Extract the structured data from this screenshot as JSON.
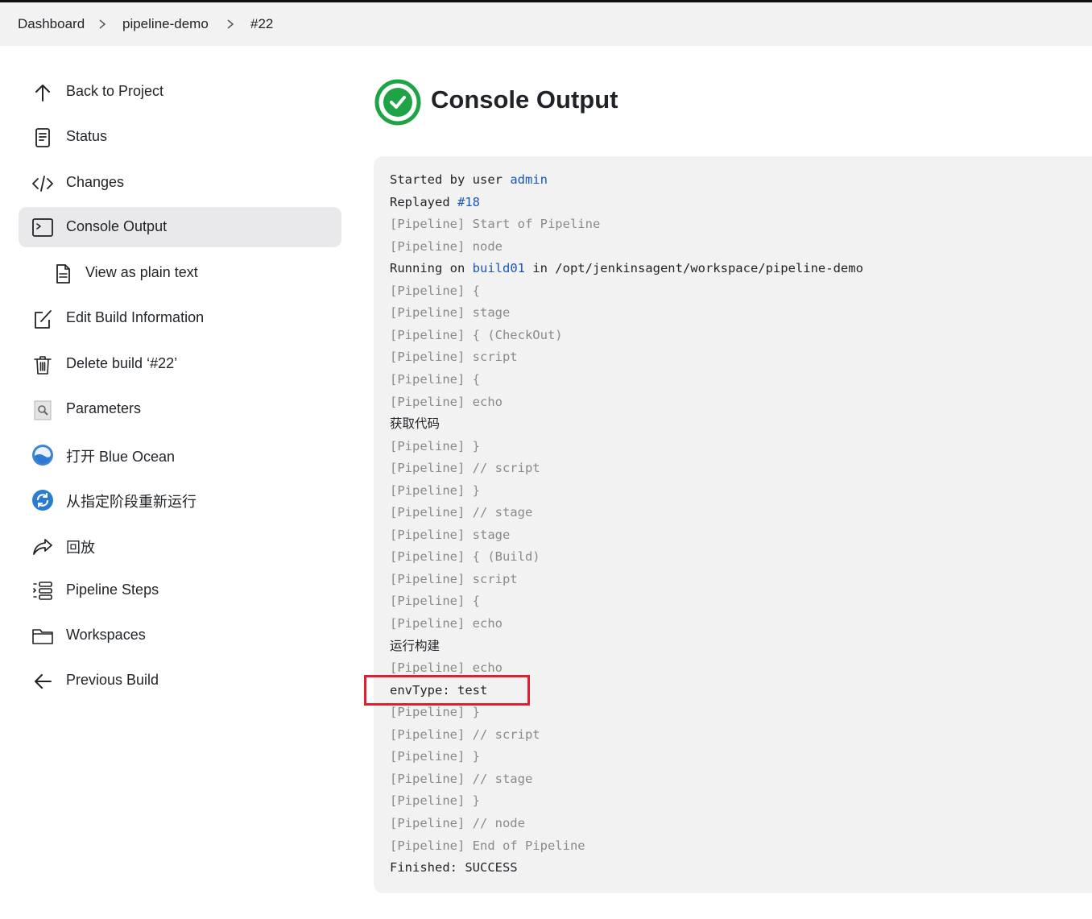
{
  "breadcrumb": {
    "items": [
      "Dashboard",
      "pipeline-demo",
      "#22"
    ]
  },
  "sidebar": {
    "items": [
      {
        "label": "Back to Project",
        "icon": "arrow-up-icon"
      },
      {
        "label": "Status",
        "icon": "document-icon"
      },
      {
        "label": "Changes",
        "icon": "code-icon"
      },
      {
        "label": "Console Output",
        "icon": "terminal-icon",
        "active": true
      },
      {
        "label": "View as plain text",
        "icon": "file-text-icon",
        "sub": true
      },
      {
        "label": "Edit Build Information",
        "icon": "edit-icon"
      },
      {
        "label": "Delete build ‘#22’",
        "icon": "trash-icon"
      },
      {
        "label": "Parameters",
        "icon": "parameters-icon"
      },
      {
        "label": "打开 Blue Ocean",
        "icon": "blue-ocean-icon"
      },
      {
        "label": "从指定阶段重新运行",
        "icon": "restart-stage-icon"
      },
      {
        "label": "回放",
        "icon": "replay-icon"
      },
      {
        "label": "Pipeline Steps",
        "icon": "list-icon"
      },
      {
        "label": "Workspaces",
        "icon": "folder-icon"
      },
      {
        "label": "Previous Build",
        "icon": "arrow-left-icon"
      }
    ]
  },
  "main": {
    "title": "Console Output",
    "status_icon": "success-check-icon",
    "status_color": "#1ea446"
  },
  "console": {
    "lines": [
      {
        "pre": "Started by user ",
        "link": "admin",
        "post": "",
        "style": "norm"
      },
      {
        "pre": "Replayed ",
        "link": "#18",
        "post": "",
        "style": "norm"
      },
      {
        "pre": "[Pipeline] Start of Pipeline",
        "style": "dim"
      },
      {
        "pre": "[Pipeline] node",
        "style": "dim"
      },
      {
        "pre": "Running on ",
        "link": "build01",
        "post": " in /opt/jenkinsagent/workspace/pipeline-demo",
        "style": "norm"
      },
      {
        "pre": "[Pipeline] {",
        "style": "dim"
      },
      {
        "pre": "[Pipeline] stage",
        "style": "dim"
      },
      {
        "pre": "[Pipeline] { (CheckOut)",
        "style": "dim"
      },
      {
        "pre": "[Pipeline] script",
        "style": "dim"
      },
      {
        "pre": "[Pipeline] {",
        "style": "dim"
      },
      {
        "pre": "[Pipeline] echo",
        "style": "dim"
      },
      {
        "pre": "获取代码",
        "style": "norm"
      },
      {
        "pre": "[Pipeline] }",
        "style": "dim"
      },
      {
        "pre": "[Pipeline] // script",
        "style": "dim"
      },
      {
        "pre": "[Pipeline] }",
        "style": "dim"
      },
      {
        "pre": "[Pipeline] // stage",
        "style": "dim"
      },
      {
        "pre": "[Pipeline] stage",
        "style": "dim"
      },
      {
        "pre": "[Pipeline] { (Build)",
        "style": "dim"
      },
      {
        "pre": "[Pipeline] script",
        "style": "dim"
      },
      {
        "pre": "[Pipeline] {",
        "style": "dim"
      },
      {
        "pre": "[Pipeline] echo",
        "style": "dim"
      },
      {
        "pre": "运行构建",
        "style": "norm"
      },
      {
        "pre": "[Pipeline] echo",
        "style": "dim"
      },
      {
        "pre": "envType: test",
        "style": "norm"
      },
      {
        "pre": "[Pipeline] }",
        "style": "dim"
      },
      {
        "pre": "[Pipeline] // script",
        "style": "dim"
      },
      {
        "pre": "[Pipeline] }",
        "style": "dim"
      },
      {
        "pre": "[Pipeline] // stage",
        "style": "dim"
      },
      {
        "pre": "[Pipeline] }",
        "style": "dim"
      },
      {
        "pre": "[Pipeline] // node",
        "style": "dim"
      },
      {
        "pre": "[Pipeline] End of Pipeline",
        "style": "dim"
      },
      {
        "pre": "Finished: SUCCESS",
        "style": "norm"
      }
    ],
    "highlight_color": "#e02030"
  }
}
